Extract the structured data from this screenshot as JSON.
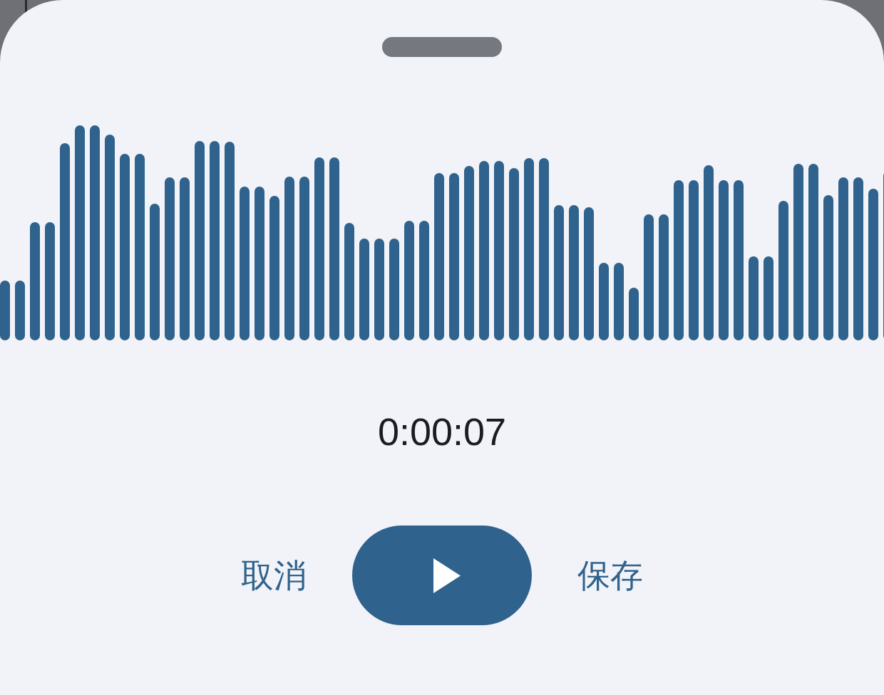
{
  "recorder": {
    "elapsed": "0:00:07",
    "cancel_button": {
      "label": "取消"
    },
    "play_button": {
      "playing": false
    },
    "save_button": {
      "label": "保存"
    }
  }
}
